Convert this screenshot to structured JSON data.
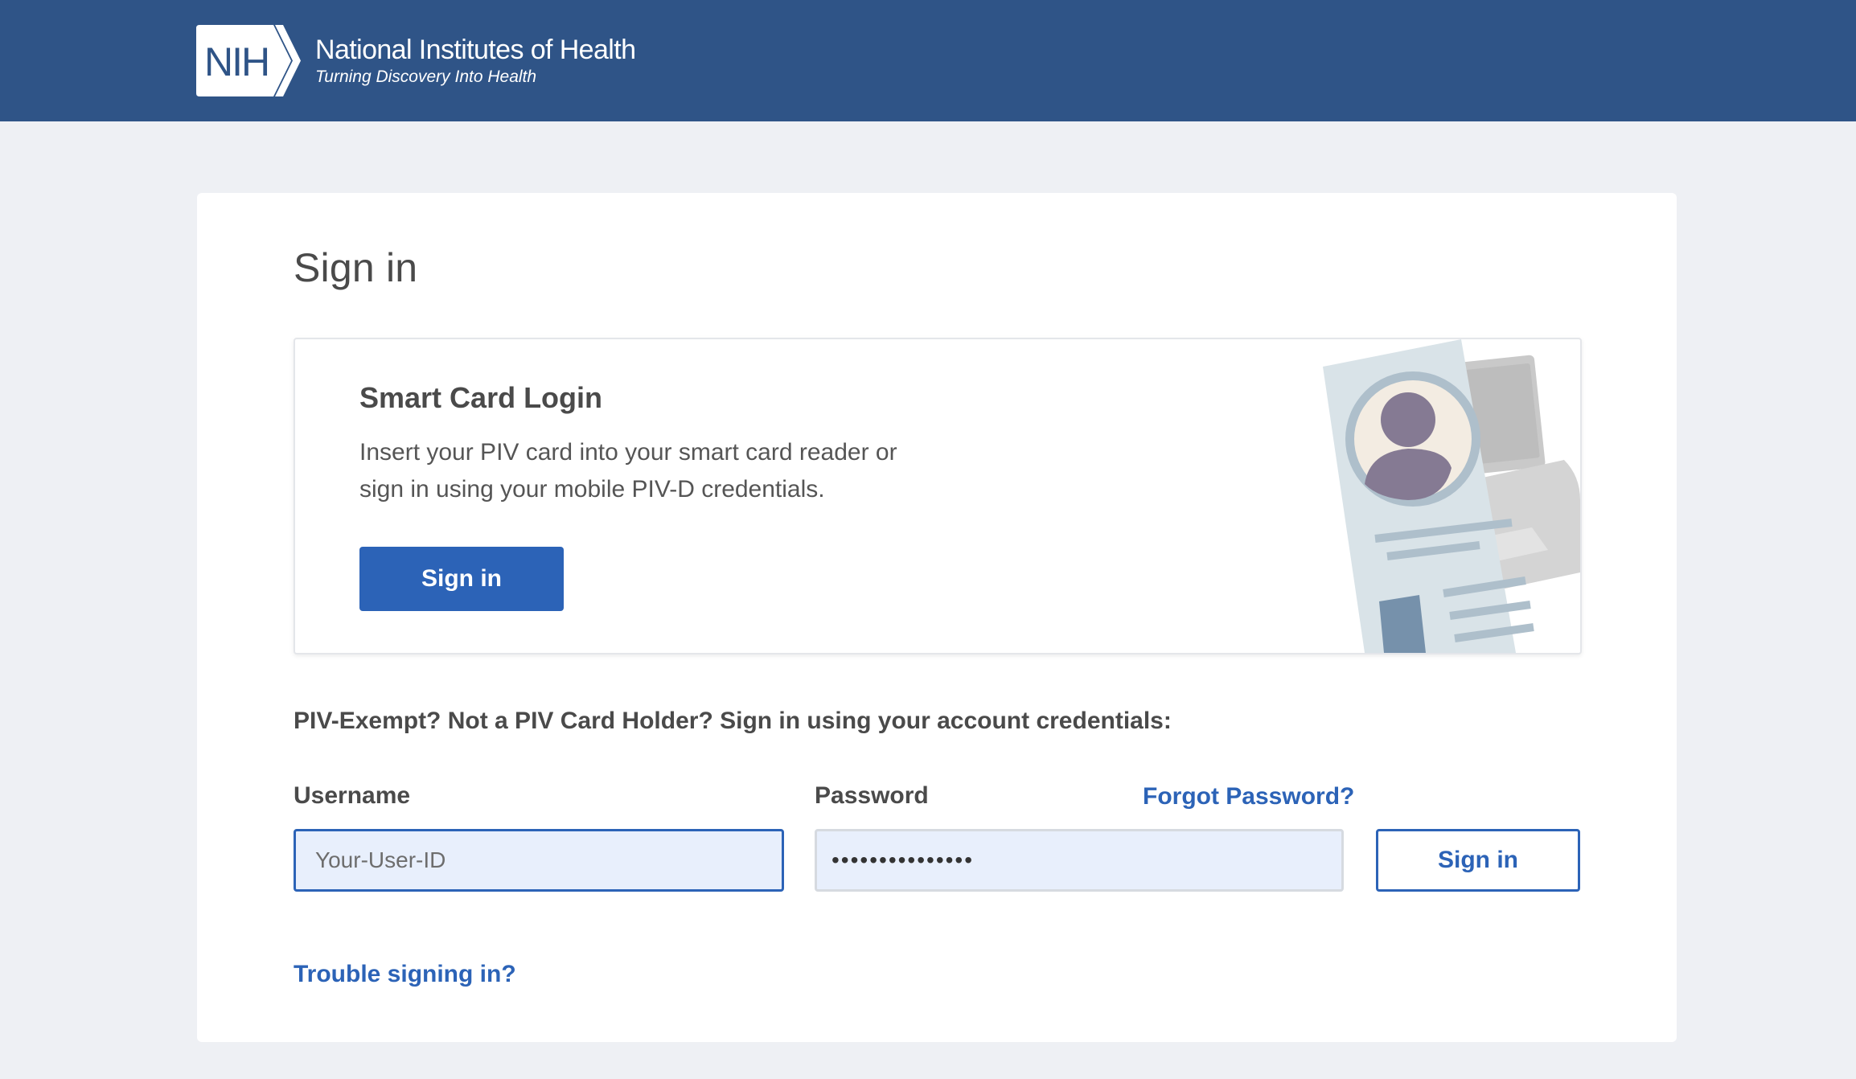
{
  "header": {
    "logo_abbrev": "NIH",
    "org_name": "National Institutes of Health",
    "tagline": "Turning Discovery Into Health",
    "bar_color": "#2f5487"
  },
  "main": {
    "title": "Sign in",
    "smart_card": {
      "title": "Smart Card Login",
      "description": "Insert your PIV card into your smart card reader or sign in using your mobile PIV-D credentials.",
      "button_label": "Sign in",
      "illustration": "piv-card-illustration"
    },
    "exempt_text": "PIV-Exempt? Not a PIV Card Holder? Sign in using your account credentials:",
    "username": {
      "label": "Username",
      "placeholder": "Your-User-ID",
      "value": ""
    },
    "password": {
      "label": "Password",
      "value": "•••••••••••••••",
      "forgot_link": "Forgot Password?"
    },
    "credentials_button_label": "Sign in",
    "trouble_link": "Trouble signing in?"
  },
  "colors": {
    "accent": "#2c63b7",
    "page_background": "#eef0f4",
    "input_background": "#e8effc"
  }
}
